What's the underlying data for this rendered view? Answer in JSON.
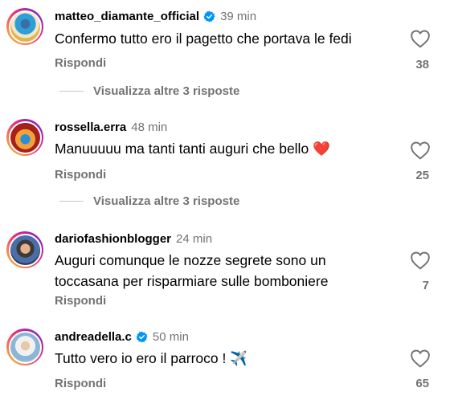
{
  "comments": [
    {
      "username": "matteo_diamante_official",
      "verified": true,
      "time": "39 min",
      "text": "Confermo tutto ero il pagetto che portava le fedi",
      "reply_label": "Rispondi",
      "likes": "38",
      "view_more": "Visualizza altre 3 risposte"
    },
    {
      "username": "rossella.erra",
      "verified": false,
      "time": "48 min",
      "text": "Manuuuuu ma tanti tanti auguri che bello ❤️",
      "reply_label": "Rispondi",
      "likes": "25",
      "view_more": "Visualizza altre 3 risposte"
    },
    {
      "username": "dariofashionblogger",
      "verified": false,
      "time": "24 min",
      "text": "Auguri comunque le nozze segrete sono un toccasana per risparmiare sulle bomboniere",
      "reply_label": "Rispondi",
      "likes": "7"
    },
    {
      "username": "andreadella.c",
      "verified": true,
      "time": "50 min",
      "text": "Tutto vero io ero il parroco ! ✈️",
      "reply_label": "Rispondi",
      "likes": "65"
    }
  ],
  "colors": {
    "verified": "#0095f6",
    "secondary_text": "#737373"
  },
  "icons": {
    "like": "heart-outline-icon",
    "verified": "verified-badge-icon"
  }
}
